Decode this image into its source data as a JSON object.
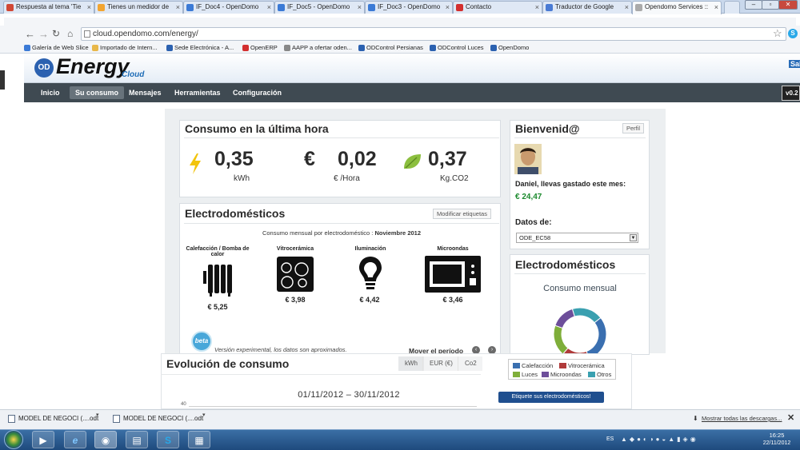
{
  "browser": {
    "tabs": [
      {
        "title": "Respuesta al tema 'Tie",
        "color": "#d14836"
      },
      {
        "title": "Tienes un medidor de",
        "color": "#f2a531"
      },
      {
        "title": "IF_Doc4 - OpenDomo",
        "color": "#3b7ad6"
      },
      {
        "title": "IF_Doc5 - OpenDomo",
        "color": "#3b7ad6"
      },
      {
        "title": "IF_Doc3 - OpenDomo",
        "color": "#3b7ad6"
      },
      {
        "title": "Contacto",
        "color": "#d32f2f"
      },
      {
        "title": "Traductor de Google",
        "color": "#4a7bd4"
      },
      {
        "title": "Opendomo Services ::",
        "color": "#aaaaaa"
      }
    ],
    "url": "cloud.opendomo.com/energy/",
    "bookmarks": [
      {
        "label": "Galería de Web Slice",
        "color": "#3b7ad6"
      },
      {
        "label": "Importado de Intern...",
        "color": "#e8b84a"
      },
      {
        "label": "Sede Electrónica - A...",
        "color": "#2b61b0"
      },
      {
        "label": "OpenERP",
        "color": "#d32f2f"
      },
      {
        "label": "AAPP a ofertar oden...",
        "color": "#888888"
      },
      {
        "label": "ODControl Persianas",
        "color": "#2b61b0"
      },
      {
        "label": "ODControl Luces",
        "color": "#2b61b0"
      },
      {
        "label": "OpenDomo",
        "color": "#2b61b0"
      }
    ]
  },
  "site": {
    "logo_badge": "OD",
    "logo": "Energy",
    "logo_sub": "Cloud",
    "header_right": "Sal",
    "nav": [
      "Inicio",
      "Su consumo",
      "Mensajes",
      "Herramientas",
      "Configuración"
    ],
    "version": "v0.2"
  },
  "last_hour": {
    "title": "Consumo en la última hora",
    "kwh": "0,35",
    "kwh_unit": "kWh",
    "euro_symbol": "€",
    "euro": "0,02",
    "euro_unit": "€ /Hora",
    "co2": "0,37",
    "co2_unit": "Kg.CO2"
  },
  "appliances": {
    "title": "Electrodomésticos",
    "modify_button": "Modificar etiquetas",
    "subtitle_prefix": "Consumo mensual por electrodoméstico :",
    "subtitle_month": "Noviembre 2012",
    "items": [
      {
        "name": "Calefacción / Bomba de calor",
        "price": "€ 5,25"
      },
      {
        "name": "Vitrocerámica",
        "price": "€ 3,98"
      },
      {
        "name": "Iluminación",
        "price": "€ 4,42"
      },
      {
        "name": "Microondas",
        "price": "€ 3,46"
      }
    ],
    "beta": "beta",
    "note": "Versión experimental, los datos son aproximados.",
    "move_period": "Mover el período"
  },
  "welcome": {
    "title": "Bienvenid@",
    "profile_button": "Perfil",
    "spent_text": "Daniel, llevas gastado este mes:",
    "spent_value": "€ 24,47",
    "data_label": "Datos de:",
    "data_select": "ODE_EC58"
  },
  "side_appliances": {
    "title": "Electrodomésticos",
    "chart_title": "Consumo mensual",
    "legend": [
      {
        "name": "Calefacción",
        "color": "#3a6fb0"
      },
      {
        "name": "Vitrocerámica",
        "color": "#b03a3a"
      },
      {
        "name": "Luces",
        "color": "#7fae3a"
      },
      {
        "name": "Microondas",
        "color": "#6d4e9a"
      },
      {
        "name": "Otros",
        "color": "#3aa0b0"
      }
    ],
    "label_button": "Etiquete sus electrodomésticos!"
  },
  "chart_data": {
    "type": "pie",
    "title": "Consumo mensual",
    "categories": [
      "Calefacción",
      "Vitrocerámica",
      "Luces",
      "Microondas",
      "Otros"
    ],
    "values": [
      30,
      17,
      19,
      15,
      19
    ]
  },
  "evolution": {
    "title": "Evolución de consumo",
    "tabs": [
      "kWh",
      "EUR (€)",
      "Co2"
    ],
    "date_range": "01/11/2012 – 30/11/2012",
    "y_tick": "40"
  },
  "downloads": {
    "items": [
      "MODEL DE NEGOCI (....odt",
      "MODEL DE NEGOCI (....odt"
    ],
    "show_all": "Mostrar todas las descargas..."
  },
  "taskbar": {
    "lang": "ES",
    "time": "16:25",
    "date": "22/11/2012"
  }
}
